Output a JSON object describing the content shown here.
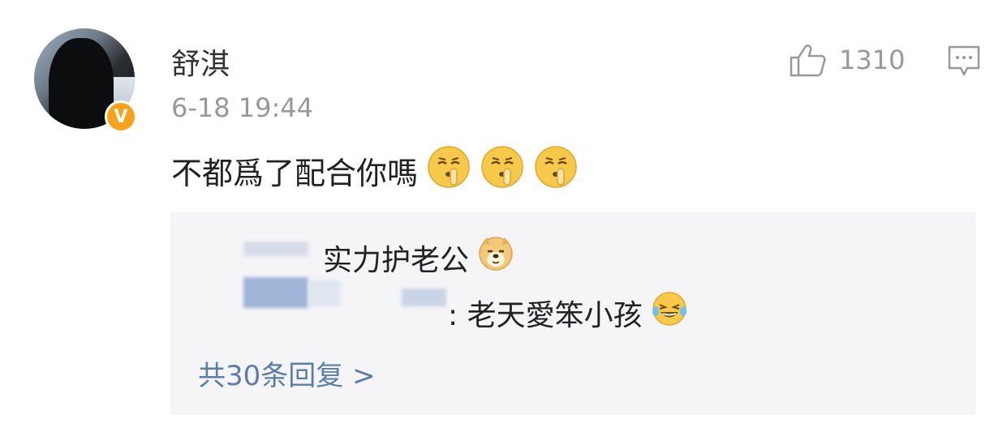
{
  "comment": {
    "username": "舒淇",
    "timestamp": "6-18 19:44",
    "like_count": "1310",
    "text": "不都爲了配合你嗎",
    "emojis": [
      "shush-face-emoji",
      "shush-face-emoji",
      "shush-face-emoji"
    ],
    "verified_badge": "V"
  },
  "replies": [
    {
      "text": "实力护老公",
      "emoji": "doge-emoji"
    },
    {
      "text": ": 老天愛笨小孩",
      "emoji": "laughing-tears-emoji"
    }
  ],
  "more_replies": "共30条回复 >",
  "colors": {
    "link": "#5a7ea8",
    "badge": "#f7a21b",
    "muted": "#999999",
    "panel": "#f5f5f7"
  }
}
